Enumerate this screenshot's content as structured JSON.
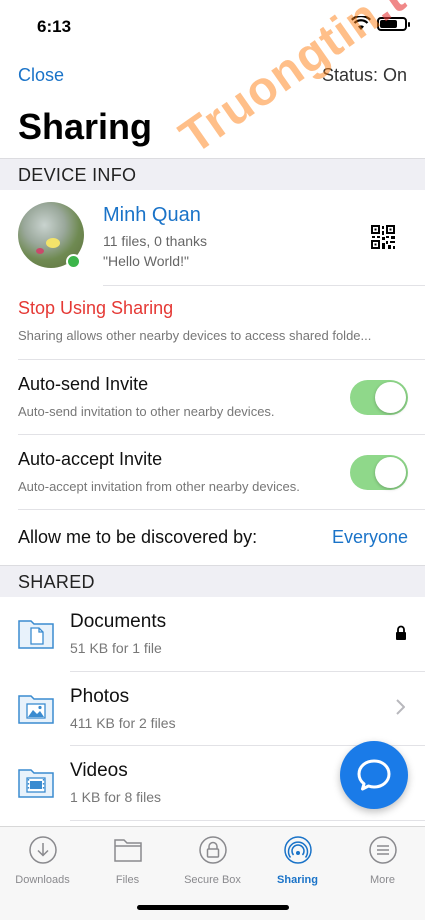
{
  "status_bar": {
    "time": "6:13"
  },
  "nav": {
    "close_label": "Close",
    "status_label": "Status: On"
  },
  "page": {
    "title": "Sharing"
  },
  "sections": {
    "device_info": "DEVICE INFO",
    "shared": "SHARED"
  },
  "device": {
    "name": "Minh Quan",
    "stats": "11 files, 0 thanks",
    "status_message": "\"Hello World!\"",
    "online": true
  },
  "stop_sharing": {
    "label": "Stop Using Sharing",
    "description": "Sharing allows other nearby devices to access shared folde..."
  },
  "toggles": [
    {
      "title": "Auto-send Invite",
      "description": "Auto-send invitation to other nearby devices.",
      "on": true
    },
    {
      "title": "Auto-accept Invite",
      "description": "Auto-accept invitation from other nearby devices.",
      "on": true
    }
  ],
  "discover": {
    "label": "Allow me to be discovered by:",
    "value": "Everyone"
  },
  "folders": [
    {
      "name": "Documents",
      "size": "51 KB for 1 file",
      "accessory": "lock-icon"
    },
    {
      "name": "Photos",
      "size": "411 KB for 2 files",
      "accessory": "chevron-right-icon"
    },
    {
      "name": "Videos",
      "size": "1 KB for 8 files",
      "accessory": "none"
    }
  ],
  "tabs": [
    {
      "label": "Downloads",
      "icon": "download-icon",
      "active": false
    },
    {
      "label": "Files",
      "icon": "folder-icon",
      "active": false
    },
    {
      "label": "Secure Box",
      "icon": "lock-icon",
      "active": false
    },
    {
      "label": "Sharing",
      "icon": "signal-icon",
      "active": true
    },
    {
      "label": "More",
      "icon": "menu-icon",
      "active": false
    }
  ],
  "watermark": {
    "text": "Truongtin",
    "tld": ".top"
  },
  "colors": {
    "accent": "#1a73c8",
    "danger": "#e53935",
    "toggle_on": "#8fd88a",
    "fab": "#1a7be8",
    "online": "#3cb54a"
  }
}
